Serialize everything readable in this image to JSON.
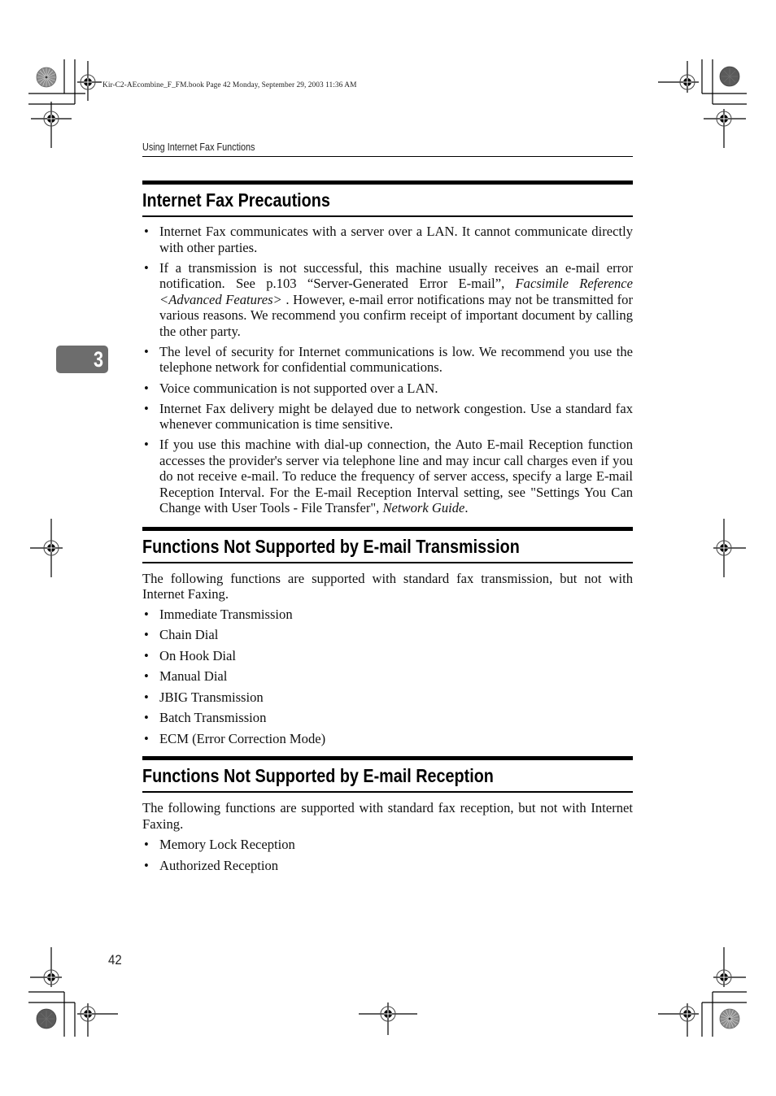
{
  "slug_line": "Kir-C2-AEcombine_F_FM.book  Page 42  Monday, September 29, 2003  11:36 AM",
  "running_header": "Using Internet Fax Functions",
  "chapter_tab": "3",
  "sections": [
    {
      "heading": "Internet Fax Precautions",
      "bullets": [
        {
          "parts": [
            {
              "text": "Internet Fax communicates with a server over a LAN. It cannot communicate directly with other parties.",
              "italic": false
            }
          ]
        },
        {
          "parts": [
            {
              "text": "If a transmission is not successful, this machine usually receives an e-mail error notification. See p.103 “Server-Generated Error E-mail”, ",
              "italic": false
            },
            {
              "text": "Facsimile Reference <Advanced Features>",
              "italic": true
            },
            {
              "text": " . However, e-mail error notifications may not be transmitted for various reasons. We recommend you confirm receipt of important document by calling the other party.",
              "italic": false
            }
          ]
        },
        {
          "parts": [
            {
              "text": "The level of security for Internet communications is low. We recommend you use the telephone network for confidential communications.",
              "italic": false
            }
          ]
        },
        {
          "parts": [
            {
              "text": "Voice communication is not supported over a LAN.",
              "italic": false
            }
          ]
        },
        {
          "parts": [
            {
              "text": "Internet Fax delivery might be delayed due to network congestion. Use a standard fax whenever communication is time sensitive.",
              "italic": false
            }
          ]
        },
        {
          "parts": [
            {
              "text": "If you use this machine with dial-up connection, the Auto E-mail Reception function accesses the provider's server via telephone line and may incur call charges even if you do not receive e-mail. To reduce the frequency of server access, specify a large E-mail Reception Interval. For the E-mail Reception Interval setting, see \"Settings You Can Change with User Tools - File Transfer\", ",
              "italic": false
            },
            {
              "text": "Network Guide",
              "italic": true
            },
            {
              "text": ".",
              "italic": false
            }
          ]
        }
      ]
    },
    {
      "heading": "Functions Not Supported by E-mail Transmission",
      "intro": "The following functions are supported with standard fax transmission, but not with Internet Faxing.",
      "items": [
        "Immediate Transmission",
        "Chain Dial",
        "On Hook Dial",
        "Manual Dial",
        "JBIG Transmission",
        "Batch Transmission",
        "ECM (Error Correction Mode)"
      ]
    },
    {
      "heading": "Functions Not Supported by E-mail Reception",
      "intro": "The following functions are supported with standard fax reception, but not with Internet Faxing.",
      "items": [
        "Memory Lock Reception",
        "Authorized Reception"
      ]
    }
  ],
  "page_number": "42",
  "bullet_glyph": "•"
}
